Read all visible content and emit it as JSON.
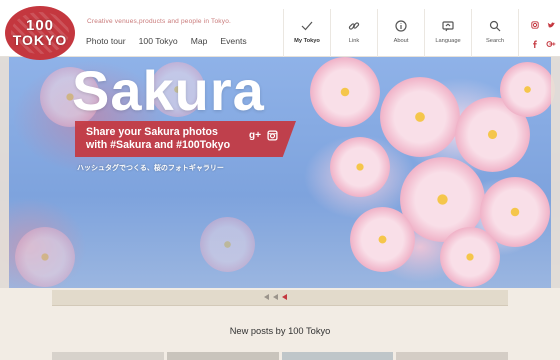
{
  "logo": {
    "line1": "100",
    "line2": "TOKYO"
  },
  "header": {
    "tagline": "Creative venues,products and people in Tokyo.",
    "nav": [
      "Photo tour",
      "100 Tokyo",
      "Map",
      "Events"
    ]
  },
  "icon_nav": [
    {
      "label": "My Tokyo",
      "icon": "check-icon"
    },
    {
      "label": "Link",
      "icon": "link-icon"
    },
    {
      "label": "About",
      "icon": "info-icon"
    },
    {
      "label": "Language",
      "icon": "language-icon"
    },
    {
      "label": "Search",
      "icon": "search-icon"
    }
  ],
  "social": [
    "instagram-icon",
    "twitter-icon",
    "facebook-icon",
    "googleplus-icon"
  ],
  "hero": {
    "title": "Sakura",
    "banner_line1": "Share your Sakura photos",
    "banner_line2": "with #Sakura and #100Tokyo",
    "banner_icons": [
      "g+",
      "ig"
    ],
    "subtitle": "ハッシュタグでつくる、桜のフォトギャラリー"
  },
  "slider": {
    "count": 3,
    "active_index": 2
  },
  "posts": {
    "title": "New posts by 100 Tokyo"
  },
  "colors": {
    "brand_red": "#c4373f",
    "sky_blue": "#8fb2e8",
    "beige": "#f2ece4"
  }
}
